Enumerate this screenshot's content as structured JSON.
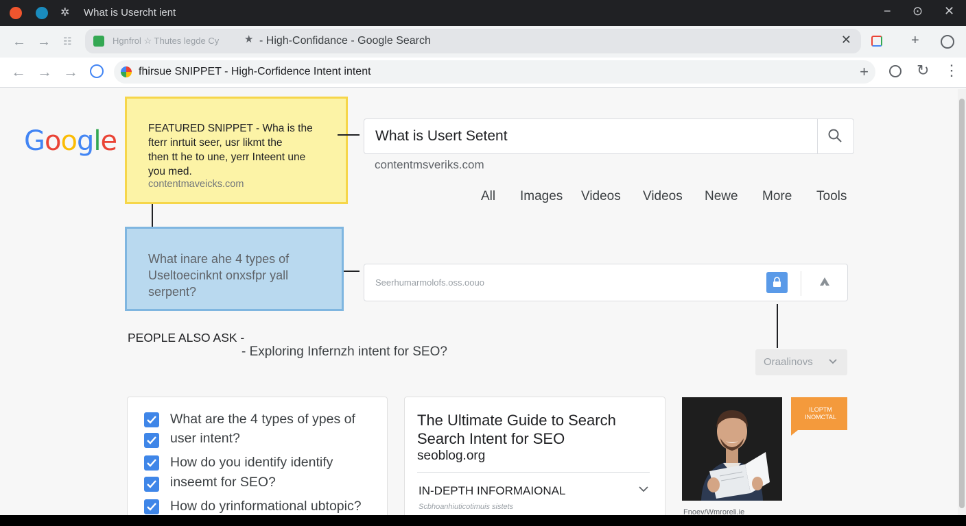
{
  "window": {
    "title": "What is Usercht ient",
    "controls": {
      "minimize": "−",
      "restore": "⊙",
      "close": "✕"
    }
  },
  "tab": {
    "subtitle": "Hgnfrol ☆  Thutes legde Cy",
    "label": "- High-Confidance - Google Search",
    "close": "✕",
    "new_tab": "+"
  },
  "address_bar": {
    "text": "fhirsue SNIPPET - High-Corfidence Intent intent",
    "plus": "+"
  },
  "logo": {
    "letters": [
      "G",
      "o",
      "o",
      "g",
      "l",
      "e"
    ],
    "colors": [
      "#4285f4",
      "#ea4335",
      "#fbbc05",
      "#4285f4",
      "#34a853",
      "#ea4335"
    ]
  },
  "featured_snippet": {
    "lines": [
      "FEATURED SNIPPET - Wha is the",
      "fterr inrtuit seer, usr likmt the",
      "then tt he to une, yerr Inteent une",
      "you med."
    ],
    "url": "contentmaveicks.com"
  },
  "search": {
    "query": "What is Usert Setent",
    "site": "contentmsveriks.com",
    "icon": "search-icon"
  },
  "nav_tabs": [
    "All",
    "Images",
    "Videos",
    "Videos",
    "Newe",
    "More",
    "Tools"
  ],
  "paa_question": {
    "lines": [
      "What inare ahe 4 types of",
      "Useltoecinknt onxsfpr yall",
      "serpent?"
    ]
  },
  "search2": {
    "placeholder": "Seerhumarmolofs.oss.oouo"
  },
  "people_also_ask": {
    "heading": "PEOPLE ALSO ASK -",
    "sub": "- Exploring Infernzh intent for SEO?"
  },
  "dropdown": {
    "label": "Oraalinovs"
  },
  "checklist": [
    "What are the 4 types of ypes of",
    "user intent?",
    "How do you identify identify",
    "inseemt for SEO?",
    "How do yrinformational ubtopic?"
  ],
  "result": {
    "title_lines": [
      "The Ultimate Guide to Search",
      "Search Intent for SEO"
    ],
    "site": "seoblog.org",
    "section": "IN-DEPTH INFORMAIONAL",
    "caption": "Scbhoanhiuticotimuis sistets"
  },
  "photo": {
    "caption": "Fnoev/Wmroreli.ie"
  },
  "badge": {
    "lines": [
      "ILOPTM",
      "INOMCTAL"
    ]
  },
  "colors": {
    "snippet_bg": "#fcf3a6",
    "snippet_border": "#f6d64a",
    "paa_bg": "#b9d9ef",
    "paa_border": "#7fb6e0",
    "checkbox": "#3f86e8",
    "badge": "#f49a3c"
  }
}
